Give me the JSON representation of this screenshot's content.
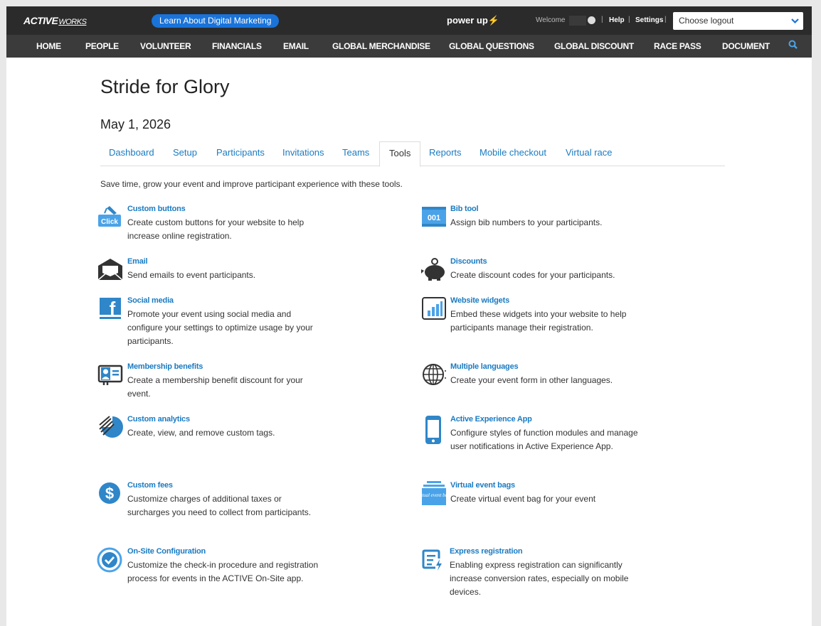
{
  "header": {
    "logo_main": "ACTIVE",
    "logo_sub": "WORKS",
    "learn_button": "Learn About Digital Marketing",
    "powerup_text": "power up",
    "welcome": "Welcome",
    "help": "Help",
    "settings": "Settings",
    "separator": "|",
    "logout_value": "Choose logout"
  },
  "nav": {
    "items": [
      "HOME",
      "PEOPLE",
      "VOLUNTEER",
      "FINANCIALS",
      "EMAIL",
      "GLOBAL MERCHANDISE",
      "GLOBAL QUESTIONS",
      "GLOBAL DISCOUNT",
      "RACE PASS",
      "DOCUMENT"
    ]
  },
  "event": {
    "title": "Stride for Glory",
    "date": "May 1, 2026"
  },
  "tabs": [
    "Dashboard",
    "Setup",
    "Participants",
    "Invitations",
    "Teams",
    "Tools",
    "Reports",
    "Mobile checkout",
    "Virtual race"
  ],
  "active_tab": "Tools",
  "intro": "Save time, grow your event and improve participant experience with these tools.",
  "tools": [
    {
      "name": "Custom buttons",
      "desc": "Create custom buttons for your website to help increase online registration.",
      "icon": "click-button-icon",
      "icon_label": "Click"
    },
    {
      "name": "Bib tool",
      "desc": "Assign bib numbers to your participants.",
      "icon": "bib-number-icon",
      "icon_label": "001"
    },
    {
      "name": "Email",
      "desc": "Send emails to event participants.",
      "icon": "envelope-icon"
    },
    {
      "name": "Discounts",
      "desc": "Create discount codes for your participants.",
      "icon": "piggy-bank-icon"
    },
    {
      "name": "Social media",
      "desc": "Promote your event using social media and configure your settings to optimize usage by your participants.",
      "icon": "facebook-icon",
      "icon_label": "f"
    },
    {
      "name": "Website widgets",
      "desc": "Embed these widgets into your website to help participants manage their registration.",
      "icon": "bar-chart-icon"
    },
    {
      "name": "Membership benefits",
      "desc": "Create a membership benefit discount for your event.",
      "icon": "membership-card-icon"
    },
    {
      "name": "Multiple languages",
      "desc": "Create your event form in other languages.",
      "icon": "globe-icon"
    },
    {
      "name": "Custom analytics",
      "desc": "Create, view, and remove custom tags.",
      "icon": "pie-chart-icon"
    },
    {
      "name": "Active Experience App",
      "desc": "Configure styles of function modules and manage user notifications in Active Experience App.",
      "icon": "mobile-phone-icon"
    },
    {
      "name": "Custom fees",
      "desc": "Customize charges of additional taxes or surcharges you need to collect from participants.",
      "icon": "dollar-icon",
      "icon_label": "$"
    },
    {
      "name": "Virtual event bags",
      "desc": "Create virtual event bag for your event",
      "icon": "virtual-bag-icon",
      "icon_label": "Virtual event bags"
    },
    {
      "name": "On-Site Configuration",
      "desc": "Customize the check-in procedure and registration process for events in the ACTIVE On-Site app.",
      "icon": "checkmark-circle-icon"
    },
    {
      "name": "Express registration",
      "desc": "Enabling express registration can significantly increase conversion rates, especially on mobile devices.",
      "icon": "express-form-icon"
    }
  ],
  "colors": {
    "topbar": "#2b2b2b",
    "navbar": "#3b3b3b",
    "accent": "#1a73d9",
    "link": "#1a7bc2",
    "icon_blue": "#2f86c8",
    "icon_dark": "#333333"
  }
}
